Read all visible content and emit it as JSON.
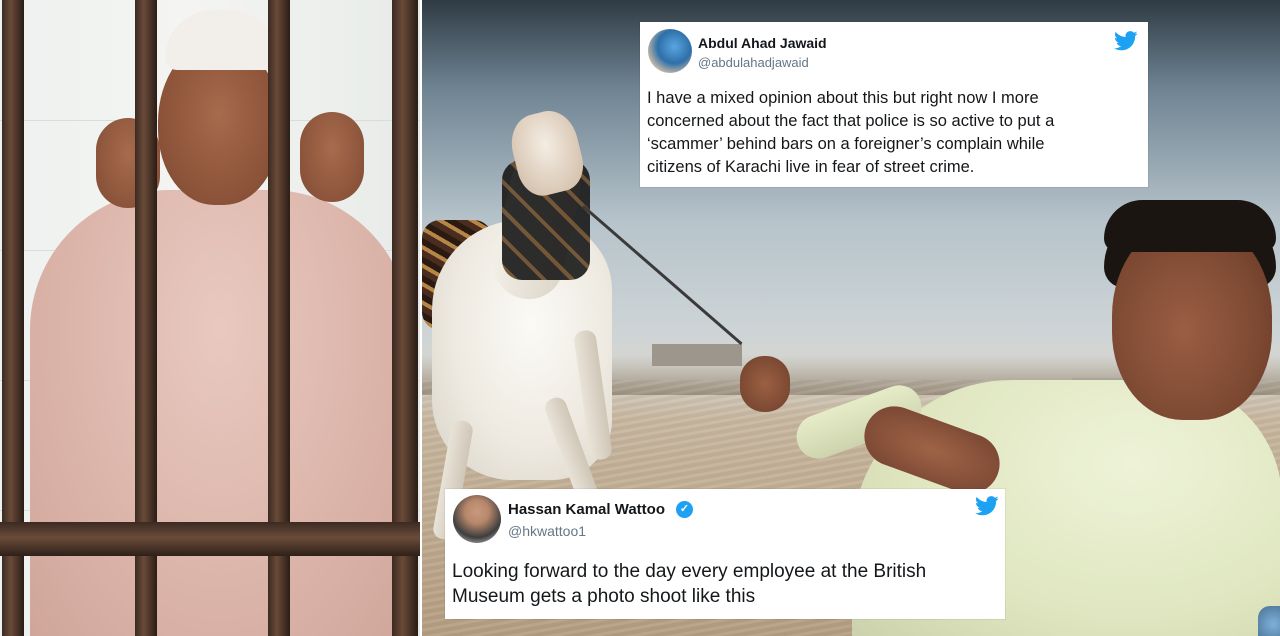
{
  "tweets": [
    {
      "name": "Abdul Ahad Jawaid",
      "handle": "@abdulahadjawaid",
      "verified": false,
      "text": "I have a mixed opinion about this but right now I more\nconcerned about the fact that police is so active to put a\n‘scammer’ behind bars on a foreigner’s complain while\ncitizens of Karachi live in fear of street crime."
    },
    {
      "name": "Hassan Kamal Wattoo",
      "handle": "@hkwattoo1",
      "verified": true,
      "text": "Looking forward to the day every employee at the British\nMuseum gets a photo shoot like this"
    }
  ],
  "icons": {
    "twitter_logo": "twitter-bird-icon",
    "verified_badge": "verified-badge-icon"
  },
  "colors": {
    "twitter_blue": "#1da1f2",
    "text_primary": "#14171a",
    "text_secondary": "#657786",
    "card_background": "#ffffff"
  }
}
